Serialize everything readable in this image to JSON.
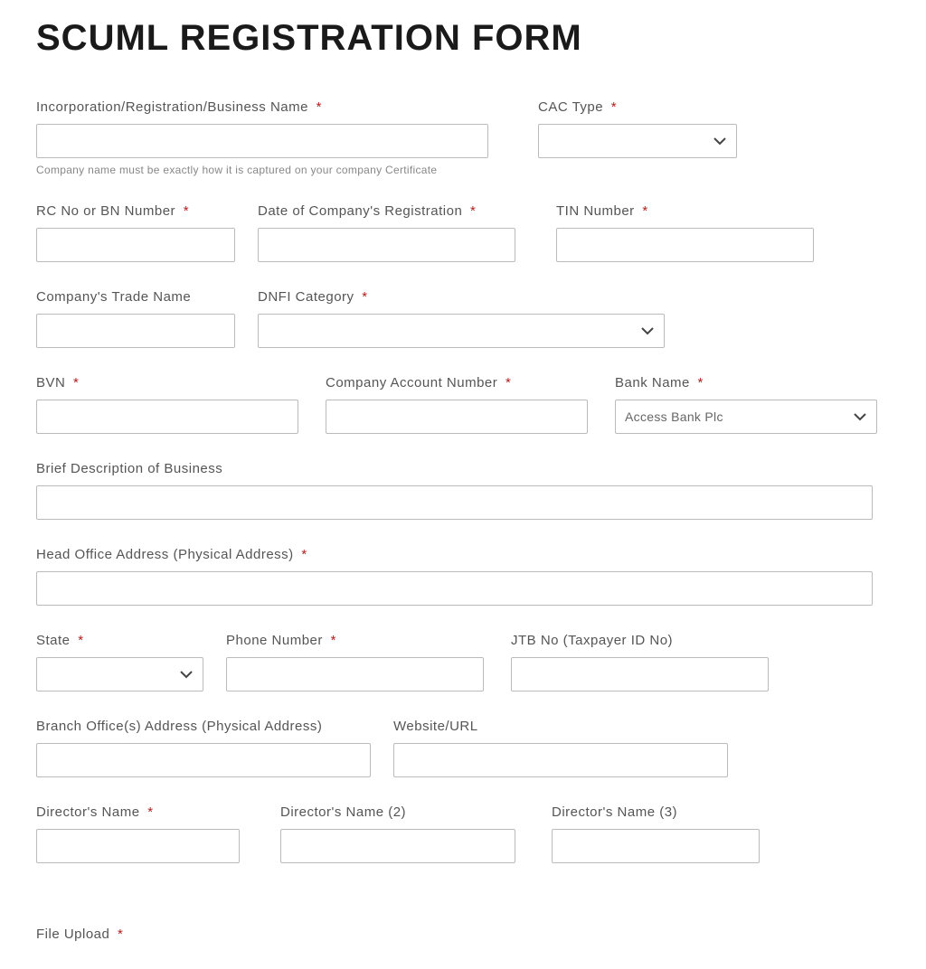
{
  "page": {
    "title": "SCUML REGISTRATION FORM"
  },
  "fields": {
    "businessName": {
      "label": "Incorporation/Registration/Business Name",
      "required": "*",
      "help": "Company name must be exactly how it is captured on your company Certificate"
    },
    "cacType": {
      "label": "CAC Type",
      "required": "*",
      "value": ""
    },
    "rcNumber": {
      "label": "RC No or BN Number",
      "required": "*"
    },
    "regDate": {
      "label": "Date of Company's Registration",
      "required": "*"
    },
    "tin": {
      "label": "TIN Number",
      "required": "*"
    },
    "tradeName": {
      "label": "Company's Trade Name"
    },
    "dnfiCategory": {
      "label": "DNFI Category",
      "required": "*",
      "value": ""
    },
    "bvn": {
      "label": "BVN",
      "required": "*"
    },
    "accountNumber": {
      "label": "Company Account Number",
      "required": "*"
    },
    "bankName": {
      "label": "Bank Name",
      "required": "*",
      "value": "Access Bank Plc"
    },
    "description": {
      "label": "Brief Description of Business"
    },
    "headOffice": {
      "label": "Head Office Address (Physical Address)",
      "required": "*"
    },
    "state": {
      "label": "State",
      "required": "*",
      "value": ""
    },
    "phone": {
      "label": "Phone Number",
      "required": "*"
    },
    "jtb": {
      "label": "JTB No (Taxpayer ID No)"
    },
    "branchOffice": {
      "label": "Branch Office(s) Address (Physical Address)"
    },
    "website": {
      "label": "Website/URL"
    },
    "director1": {
      "label": "Director's Name",
      "required": "*"
    },
    "director2": {
      "label": "Director's Name (2)"
    },
    "director3": {
      "label": "Director's Name (3)"
    },
    "fileUpload": {
      "label": "File Upload",
      "required": "*"
    }
  }
}
